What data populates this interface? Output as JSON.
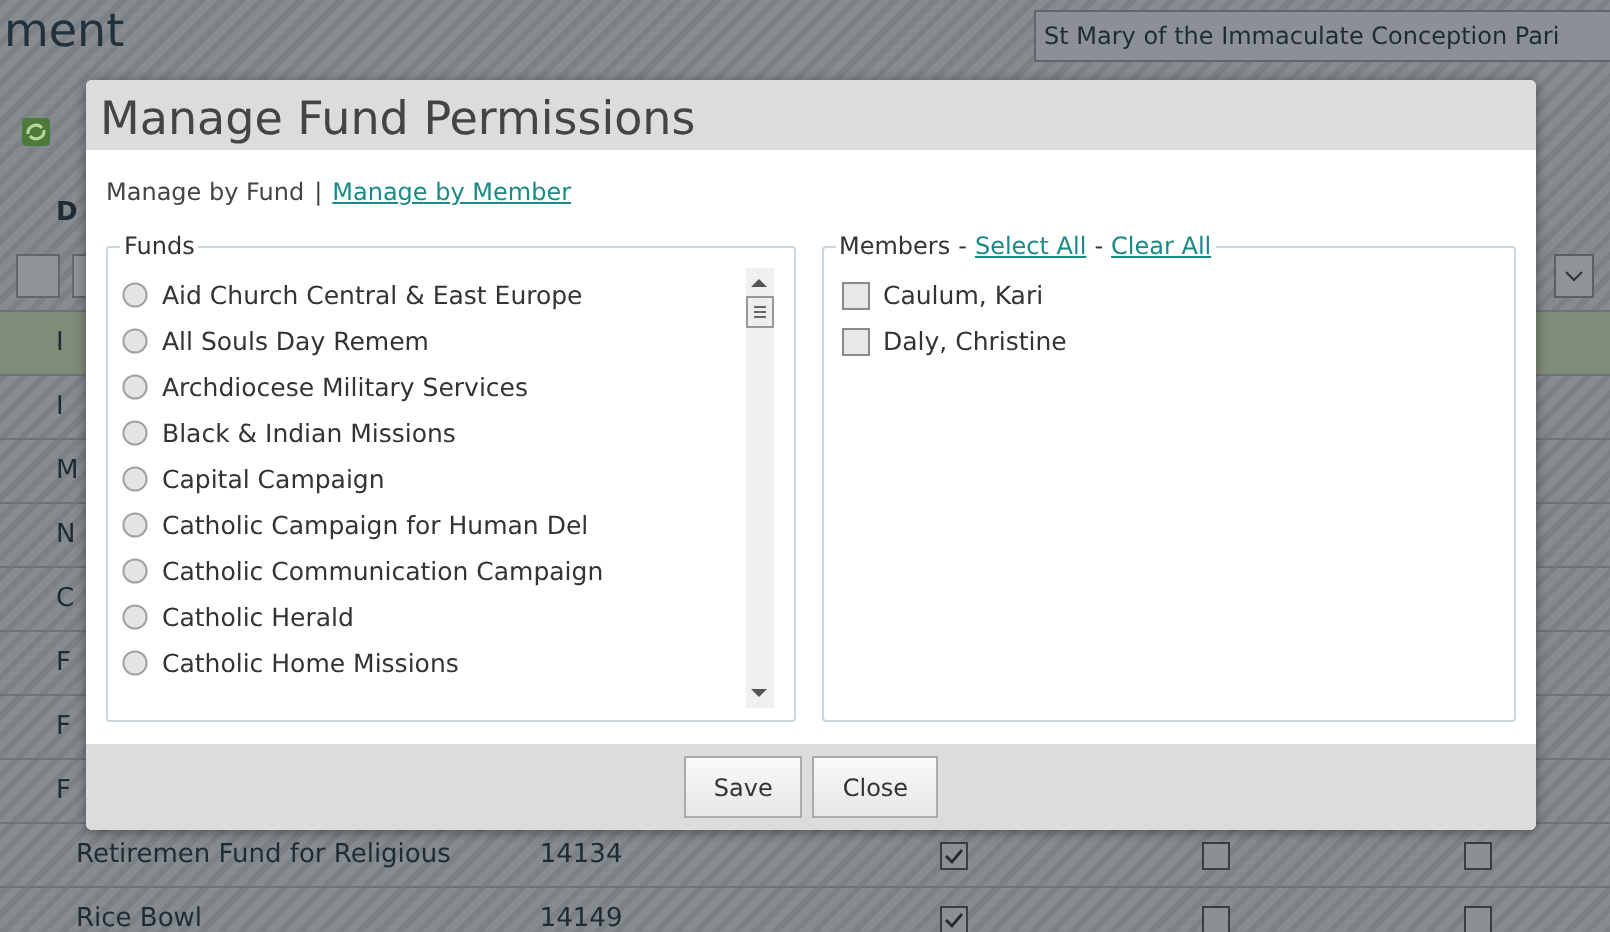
{
  "page": {
    "title": "ment",
    "organization": "St Mary of the Immaculate Conception Pari"
  },
  "table": {
    "header": "D",
    "rows": [
      {
        "name": "I",
        "highlighted": true
      },
      {
        "name": "I",
        "highlighted": false
      },
      {
        "name": "M",
        "highlighted": false
      },
      {
        "name": "N",
        "highlighted": false
      },
      {
        "name": "C",
        "highlighted": false
      },
      {
        "name": "F",
        "highlighted": false
      },
      {
        "name": "F",
        "highlighted": false
      },
      {
        "name": "F",
        "highlighted": false
      },
      {
        "name": "Retiremen Fund for Religious",
        "number": "14134",
        "highlighted": false,
        "checks": [
          true,
          false,
          false
        ]
      },
      {
        "name": "Rice Bowl",
        "number": "14149",
        "highlighted": false,
        "checks": [
          true,
          false,
          false
        ]
      }
    ]
  },
  "dialog": {
    "title": "Manage Fund Permissions",
    "nav": [
      {
        "label": "Manage by Fund",
        "selected": true
      },
      {
        "label": "Manage by Member",
        "selected": false
      }
    ],
    "nav_separator": "|",
    "funds": {
      "legend": "Funds",
      "items": [
        {
          "label": "Aid Church Central & East Europe",
          "selected": false
        },
        {
          "label": "All Souls Day Remem",
          "selected": false
        },
        {
          "label": "Archdiocese Military Services",
          "selected": false
        },
        {
          "label": "Black & Indian Missions",
          "selected": false
        },
        {
          "label": "Capital Campaign",
          "selected": false
        },
        {
          "label": "Catholic Campaign for Human Del",
          "selected": false
        },
        {
          "label": "Catholic Communication Campaign",
          "selected": false
        },
        {
          "label": "Catholic Herald",
          "selected": false
        },
        {
          "label": "Catholic Home Missions",
          "selected": false
        }
      ]
    },
    "members": {
      "legend": "Members",
      "separator": "-",
      "select_all": "Select All",
      "clear_all": "Clear All",
      "items": [
        {
          "label": "Caulum, Kari",
          "checked": false
        },
        {
          "label": "Daly, Christine",
          "checked": false
        }
      ]
    },
    "buttons": [
      "Save",
      "Close"
    ]
  }
}
